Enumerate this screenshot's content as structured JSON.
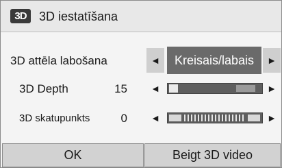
{
  "dialog": {
    "icon_text": "3D",
    "title": "3D iestatīšana"
  },
  "rows": [
    {
      "label": "3D attēla labošana",
      "value": "Kreisais/labais"
    },
    {
      "label": "3D Depth",
      "value": "15",
      "level": 0.1
    },
    {
      "label": "3D skatupunkts",
      "value": "0",
      "level": 0.5
    }
  ],
  "arrows": {
    "left": "◄",
    "right": "►"
  },
  "buttons": {
    "ok": "OK",
    "exit": "Beigt 3D video"
  },
  "colors": {
    "selected_bg": "#6a6a6a",
    "track": "#5e5e5e",
    "button_bg": "#d2d2d2"
  }
}
